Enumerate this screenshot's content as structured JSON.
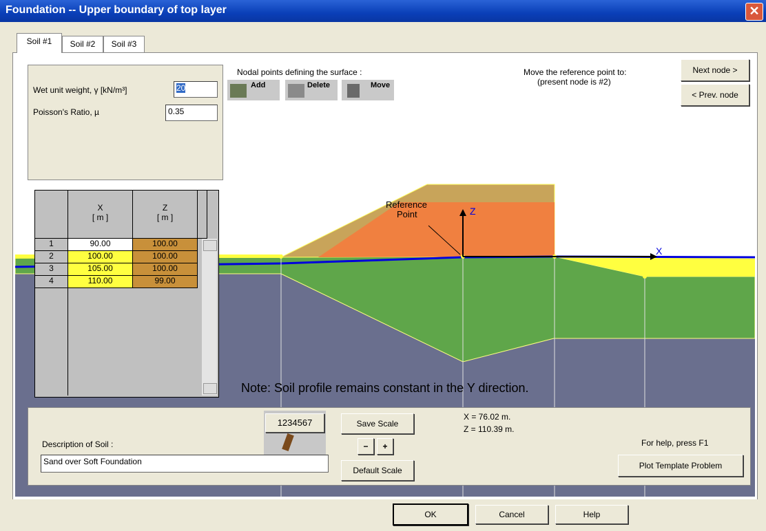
{
  "window": {
    "title": "Foundation -- Upper boundary of top layer",
    "close_symbol": "✕"
  },
  "tabs": [
    "Soil #1",
    "Soil #2",
    "Soil #3"
  ],
  "properties": {
    "wet_label": "Wet unit weight, γ [kN/m³]",
    "wet_value": "20",
    "poisson_label": "Poisson's Ratio, µ",
    "poisson_value": "0.35"
  },
  "nodal": {
    "heading": "Nodal points defining the surface :",
    "add": "Add",
    "delete": "Delete",
    "move": "Move"
  },
  "reference": {
    "heading": "Move the reference point to:",
    "present": "(present node is #2)",
    "next": "Next node >",
    "prev": "< Prev. node"
  },
  "table": {
    "col_x": "X",
    "col_z": "Z",
    "unit": "[ m ]",
    "rows": [
      {
        "n": "1",
        "x": "90.00",
        "z": "100.00"
      },
      {
        "n": "2",
        "x": "100.00",
        "z": "100.00"
      },
      {
        "n": "3",
        "x": "105.00",
        "z": "100.00"
      },
      {
        "n": "4",
        "x": "110.00",
        "z": "99.00"
      }
    ]
  },
  "plot": {
    "ref_label_1": "Reference",
    "ref_label_2": "Point",
    "z_axis": "Z",
    "x_axis": "X",
    "note": "Note: Soil profile remains constant in the Y direction."
  },
  "bottom": {
    "ruler_text": "1234567",
    "save_scale": "Save Scale",
    "default_scale": "Default Scale",
    "x_coord": "X = 76.02 m.",
    "z_coord": "Z = 110.39 m.",
    "help_hint": "For help, press F1",
    "plot_template": "Plot Template Problem",
    "description_label": "Description of Soil :",
    "description_value": "Sand over Soft Foundation"
  },
  "footer": {
    "ok": "OK",
    "cancel": "Cancel",
    "help": "Help"
  },
  "colors": {
    "sky": "#ffffff",
    "yellow_layer": "#ffff40",
    "green_layer": "#5fa64a",
    "bottom_layer": "#6a6f8e",
    "embankment": "#f08040",
    "embankment_top": "#c8a45a",
    "surface_line": "#0000dd"
  }
}
